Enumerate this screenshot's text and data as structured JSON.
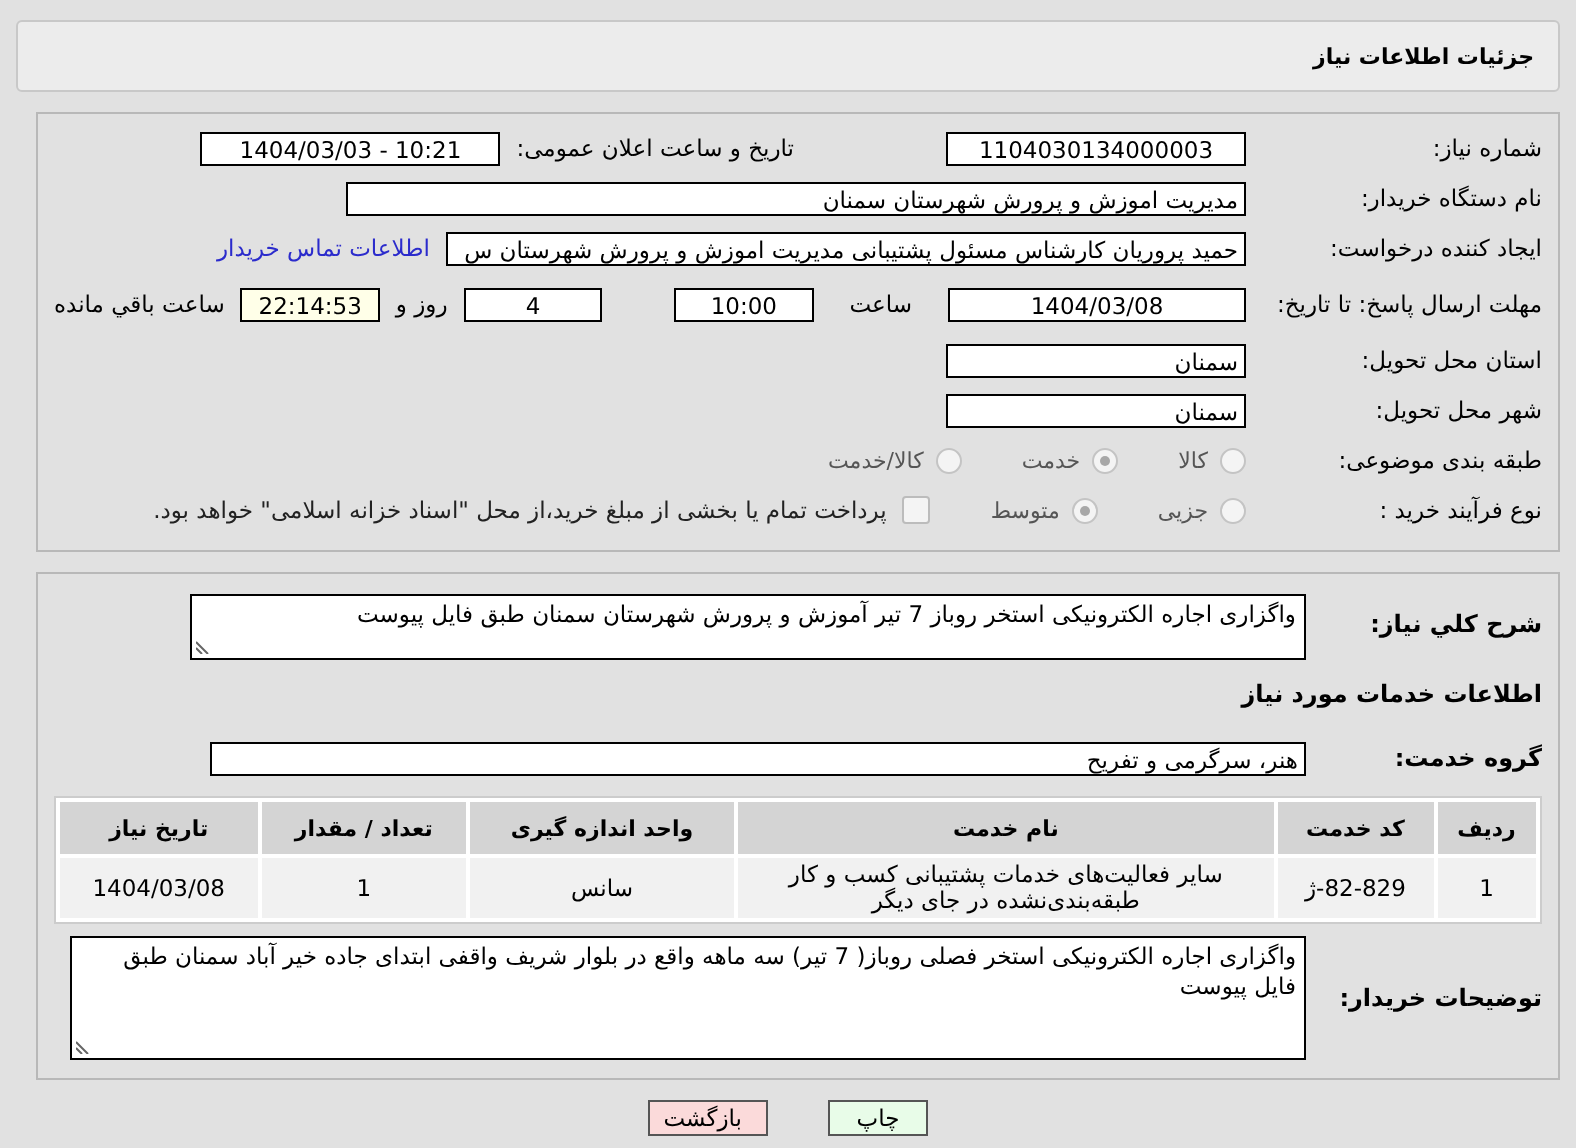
{
  "header": {
    "title": "جزئیات اطلاعات نیاز"
  },
  "need_number": {
    "label": "شماره نیاز:",
    "value": "1104030134000003"
  },
  "announce": {
    "label": "تاریخ و ساعت اعلان عمومی:",
    "value": "1404/03/03 - 10:21"
  },
  "buyer": {
    "label": "نام دستگاه خریدار:",
    "value": "مدیریت اموزش و پرورش شهرستان سمنان"
  },
  "creator": {
    "label": "ایجاد کننده درخواست:",
    "value": "حمید پروریان کارشناس مسئول پشتیبانی  مدیریت اموزش و پرورش شهرستان س",
    "link": "اطلاعات تماس خریدار"
  },
  "deadline": {
    "label": "مهلت ارسال پاسخ: تا تاریخ:",
    "date": "1404/03/08",
    "time_label": "ساعت",
    "time": "10:00",
    "days": "4",
    "days_label": "روز و",
    "remaining": "22:14:53",
    "remaining_label": "ساعت باقي مانده"
  },
  "province": {
    "label": "استان محل تحویل:",
    "value": "سمنان"
  },
  "city": {
    "label": "شهر محل تحویل:",
    "value": "سمنان"
  },
  "category": {
    "label": "طبقه بندی موضوعی:",
    "options": [
      {
        "label": "کالا",
        "selected": false
      },
      {
        "label": "خدمت",
        "selected": true
      },
      {
        "label": "کالا/خدمت",
        "selected": false
      }
    ]
  },
  "process": {
    "label": "نوع فرآیند خرید :",
    "options": [
      {
        "label": "جزیی",
        "selected": false
      },
      {
        "label": "متوسط",
        "selected": true
      }
    ],
    "treasury": {
      "label": "پرداخت تمام یا بخشی از مبلغ خرید،از محل \"اسناد خزانه اسلامی\" خواهد بود.",
      "checked": false
    }
  },
  "description": {
    "label": "شرح کلي نیاز:",
    "value": "واگزاری اجاره الکترونیکی استخر روباز 7 تیر آموزش و پرورش شهرستان سمنان طبق فایل پیوست"
  },
  "services_heading": "اطلاعات خدمات مورد نیاز",
  "service_group": {
    "label": "گروه خدمت:",
    "value": "هنر، سرگرمی و تفریح"
  },
  "table": {
    "columns": [
      "ردیف",
      "کد خدمت",
      "نام خدمت",
      "واحد اندازه گیری",
      "تعداد / مقدار",
      "تاریخ نیاز"
    ],
    "rows": [
      [
        "1",
        "82-829-ژ",
        "سایر فعالیت‌های خدمات پشتیبانی کسب و کار طبقه‌بندی‌نشده در جای دیگر",
        "سانس",
        "1",
        "1404/03/08"
      ]
    ]
  },
  "buyer_notes": {
    "label": "توضیحات خریدار:",
    "value": "واگزاری اجاره الکترونیکی استخر  فصلی روباز( 7 تیر) سه ماهه واقع در بلوار شریف واقفی ابتدای جاده خیر آباد سمنان طبق فایل پیوست"
  },
  "buttons": [
    {
      "label": "چاپ",
      "kind": "print"
    },
    {
      "label": "بازگشت",
      "kind": "back"
    }
  ]
}
